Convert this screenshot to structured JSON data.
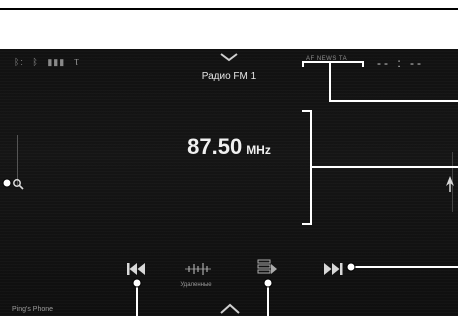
{
  "status": {
    "icons": [
      "bluetooth-icon",
      "bluetooth-icon",
      "battery-icon",
      "signal-icon"
    ]
  },
  "header": {
    "station_name": "Радио FM 1",
    "rds_tags": "AF NEWS TA",
    "clock": "-- : --"
  },
  "tuner": {
    "frequency": "87.50",
    "unit": "MHz"
  },
  "controls": {
    "prev_icon": "skip-previous-icon",
    "favorites_icon": "favorites-icon",
    "favorites_label": "Удаленные",
    "list_icon": "station-list-icon",
    "next_icon": "skip-next-icon"
  },
  "footer": {
    "device_name": "Ping's Phone"
  },
  "colors": {
    "background": "#121212",
    "text": "#f0f0f0",
    "callout": "#ffffff"
  }
}
